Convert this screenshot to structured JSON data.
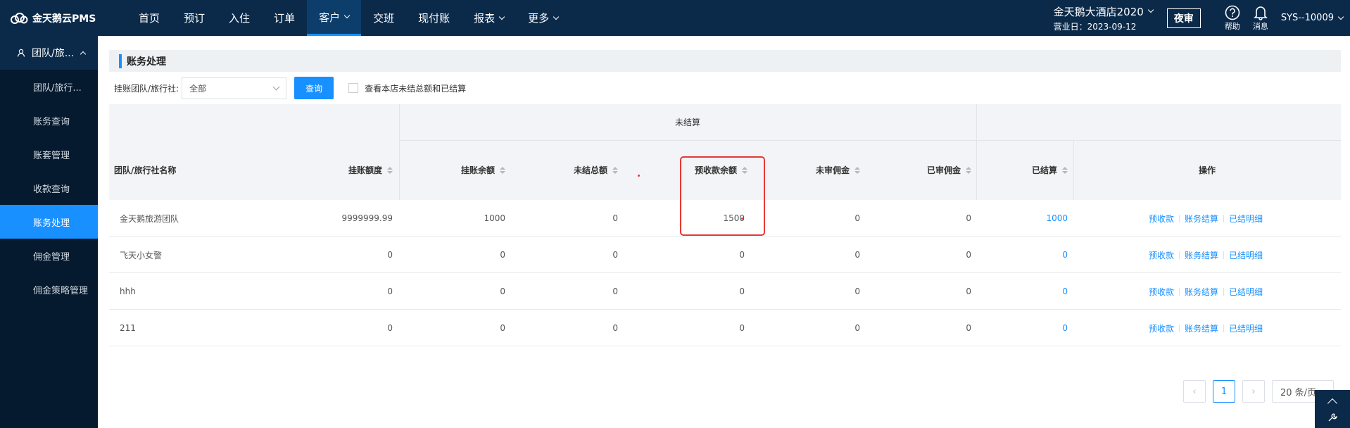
{
  "brand": {
    "name": "金天鹅云PMS"
  },
  "nav": {
    "items": [
      {
        "label": "首页",
        "dropdown": false,
        "active": false
      },
      {
        "label": "预订",
        "dropdown": false,
        "active": false
      },
      {
        "label": "入住",
        "dropdown": false,
        "active": false
      },
      {
        "label": "订单",
        "dropdown": false,
        "active": false
      },
      {
        "label": "客户",
        "dropdown": true,
        "active": true
      },
      {
        "label": "交班",
        "dropdown": false,
        "active": false
      },
      {
        "label": "现付账",
        "dropdown": false,
        "active": false
      },
      {
        "label": "报表",
        "dropdown": true,
        "active": false
      },
      {
        "label": "更多",
        "dropdown": true,
        "active": false
      }
    ]
  },
  "header": {
    "hotel": "金天鹅大酒店2020",
    "business_day": "营业日：2023-09-12",
    "night_audit": "夜审",
    "help": "帮助",
    "messages": "消息",
    "user": "SYS--10009"
  },
  "sidebar": {
    "group": "团队/旅...",
    "items": [
      {
        "label": "团队/旅行...",
        "active": false
      },
      {
        "label": "账务查询",
        "active": false
      },
      {
        "label": "账套管理",
        "active": false
      },
      {
        "label": "收款查询",
        "active": false
      },
      {
        "label": "账务处理",
        "active": true
      },
      {
        "label": "佣金管理",
        "active": false
      },
      {
        "label": "佣金策略管理",
        "active": false
      }
    ]
  },
  "page": {
    "title": "账务处理"
  },
  "filter": {
    "label": "挂账团队/旅行社:",
    "select_value": "全部",
    "query_button": "查询",
    "checkbox_label": "查看本店未结总额和已结算"
  },
  "table": {
    "group_unsettled": "未结算",
    "headers": {
      "name": "团队/旅行社名称",
      "credit_limit": "挂账额度",
      "credit_balance": "挂账余额",
      "unsettled_total": "未结总额",
      "prepaid_balance": "预收款余额",
      "unaudited_commission": "未审佣金",
      "audited_commission": "已审佣金",
      "settled": "已结算",
      "actions": "操作"
    },
    "rows": [
      {
        "name": "金天鹅旅游团队",
        "credit_limit": "9999999.99",
        "credit_balance": "1000",
        "unsettled_total": "0",
        "prepaid_balance": "1500",
        "unaudited_commission": "0",
        "audited_commission": "0",
        "settled": "1000"
      },
      {
        "name": "飞天小女警",
        "credit_limit": "0",
        "credit_balance": "0",
        "unsettled_total": "0",
        "prepaid_balance": "0",
        "unaudited_commission": "0",
        "audited_commission": "0",
        "settled": "0"
      },
      {
        "name": "hhh",
        "credit_limit": "0",
        "credit_balance": "0",
        "unsettled_total": "0",
        "prepaid_balance": "0",
        "unaudited_commission": "0",
        "audited_commission": "0",
        "settled": "0"
      },
      {
        "name": "211",
        "credit_limit": "0",
        "credit_balance": "0",
        "unsettled_total": "0",
        "prepaid_balance": "0",
        "unaudited_commission": "0",
        "audited_commission": "0",
        "settled": "0"
      }
    ],
    "actions": [
      "预收款",
      "账务结算",
      "已结明细"
    ]
  },
  "pagination": {
    "current": "1",
    "page_size": "20 条/页"
  },
  "colors": {
    "accent": "#1890ff",
    "topbar": "#0b2a4a",
    "sidebar": "#051a2f",
    "highlight": "#e53935"
  }
}
